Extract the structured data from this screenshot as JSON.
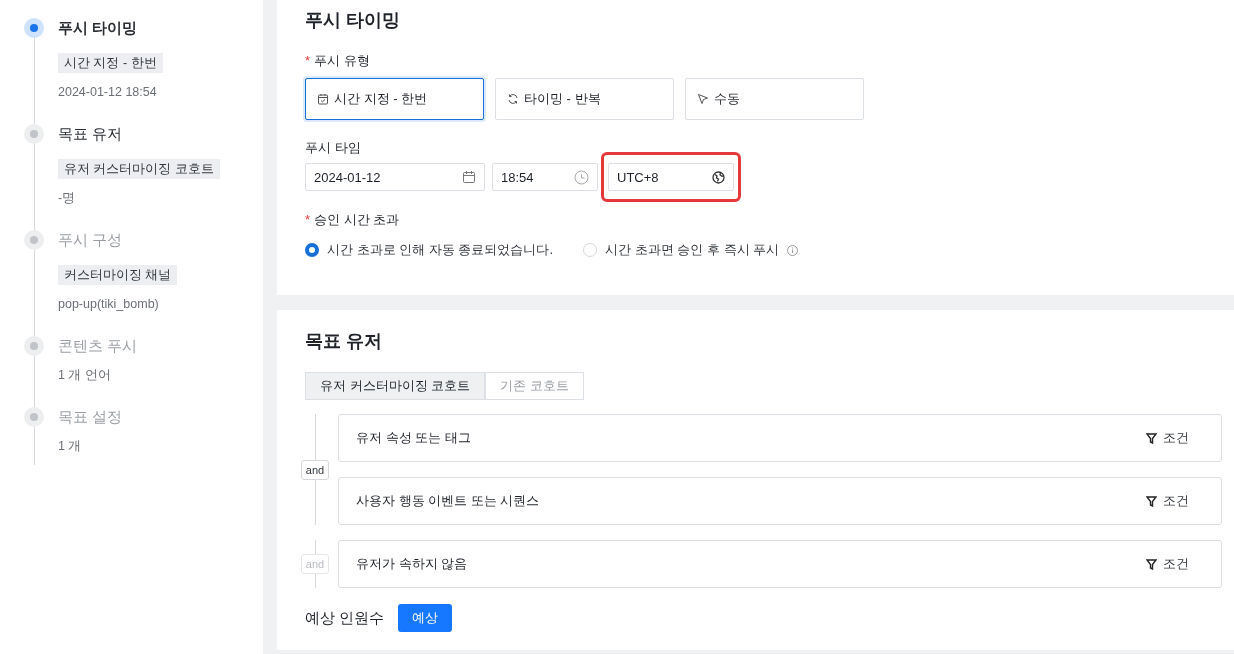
{
  "steps": [
    {
      "title": "푸시 타이밍",
      "active": true,
      "visited": true,
      "tag": "시간 지정 - 한번",
      "detail": "2024-01-12 18:54"
    },
    {
      "title": "목표 유저",
      "active": false,
      "visited": true,
      "tag": "유저 커스터마이징 코호트",
      "detail": "-명"
    },
    {
      "title": "푸시 구성",
      "active": false,
      "visited": false,
      "tag": "커스터마이징 채널",
      "detail": "pop-up(tiki_bomb)"
    },
    {
      "title": "콘텐츠 푸시",
      "active": false,
      "visited": false,
      "detail": "1 개 언어"
    },
    {
      "title": "목표 설정",
      "active": false,
      "visited": false,
      "detail": "1 개"
    }
  ],
  "timing": {
    "title": "푸시 타이밍",
    "type_label": {
      "text": "푸시 유형",
      "required_mark": "*"
    },
    "types": [
      {
        "label": "시간 지정 - 한번",
        "kind": "once",
        "selected": true
      },
      {
        "label": "타이밍 - 반복",
        "kind": "repeat",
        "selected": false
      },
      {
        "label": "수동",
        "kind": "manual",
        "selected": false
      }
    ],
    "time_label": {
      "text": "푸시 타임"
    },
    "fields": [
      {
        "value": "2024-01-12",
        "kind": "date",
        "highlighted": false
      },
      {
        "value": "18:54",
        "kind": "time",
        "highlighted": false
      },
      {
        "value": "UTC+8",
        "kind": "timezone",
        "highlighted": true
      }
    ],
    "timeout_label": {
      "text": "승인 시간 초과",
      "required_mark": "*"
    },
    "timeout_options": [
      {
        "label": "시간 초과로 인해 자동 종료되었습니다.",
        "selected": true,
        "info": false
      },
      {
        "label": "시간 초과면 승인 후 즉시 푸시",
        "selected": false,
        "info": true
      }
    ]
  },
  "target": {
    "title": "목표 유저",
    "tabs": [
      {
        "label": "유저 커스터마이징 코호트",
        "selected": true
      },
      {
        "label": "기존 코호트",
        "selected": false
      }
    ],
    "groups": [
      {
        "connector": {
          "label": "and",
          "disabled": false
        },
        "conditions": [
          {
            "label": "유저 속성 또는 태그",
            "action": "조건"
          },
          {
            "label": "사용자 행동 이벤트 또는 시퀀스",
            "action": "조건"
          }
        ]
      },
      {
        "connector": {
          "label": "and",
          "disabled": true
        },
        "conditions": [
          {
            "label": "유저가 속하지 않음",
            "action": "조건"
          }
        ]
      }
    ],
    "estimate": {
      "label": "예상 인원수",
      "button": "예상"
    }
  }
}
